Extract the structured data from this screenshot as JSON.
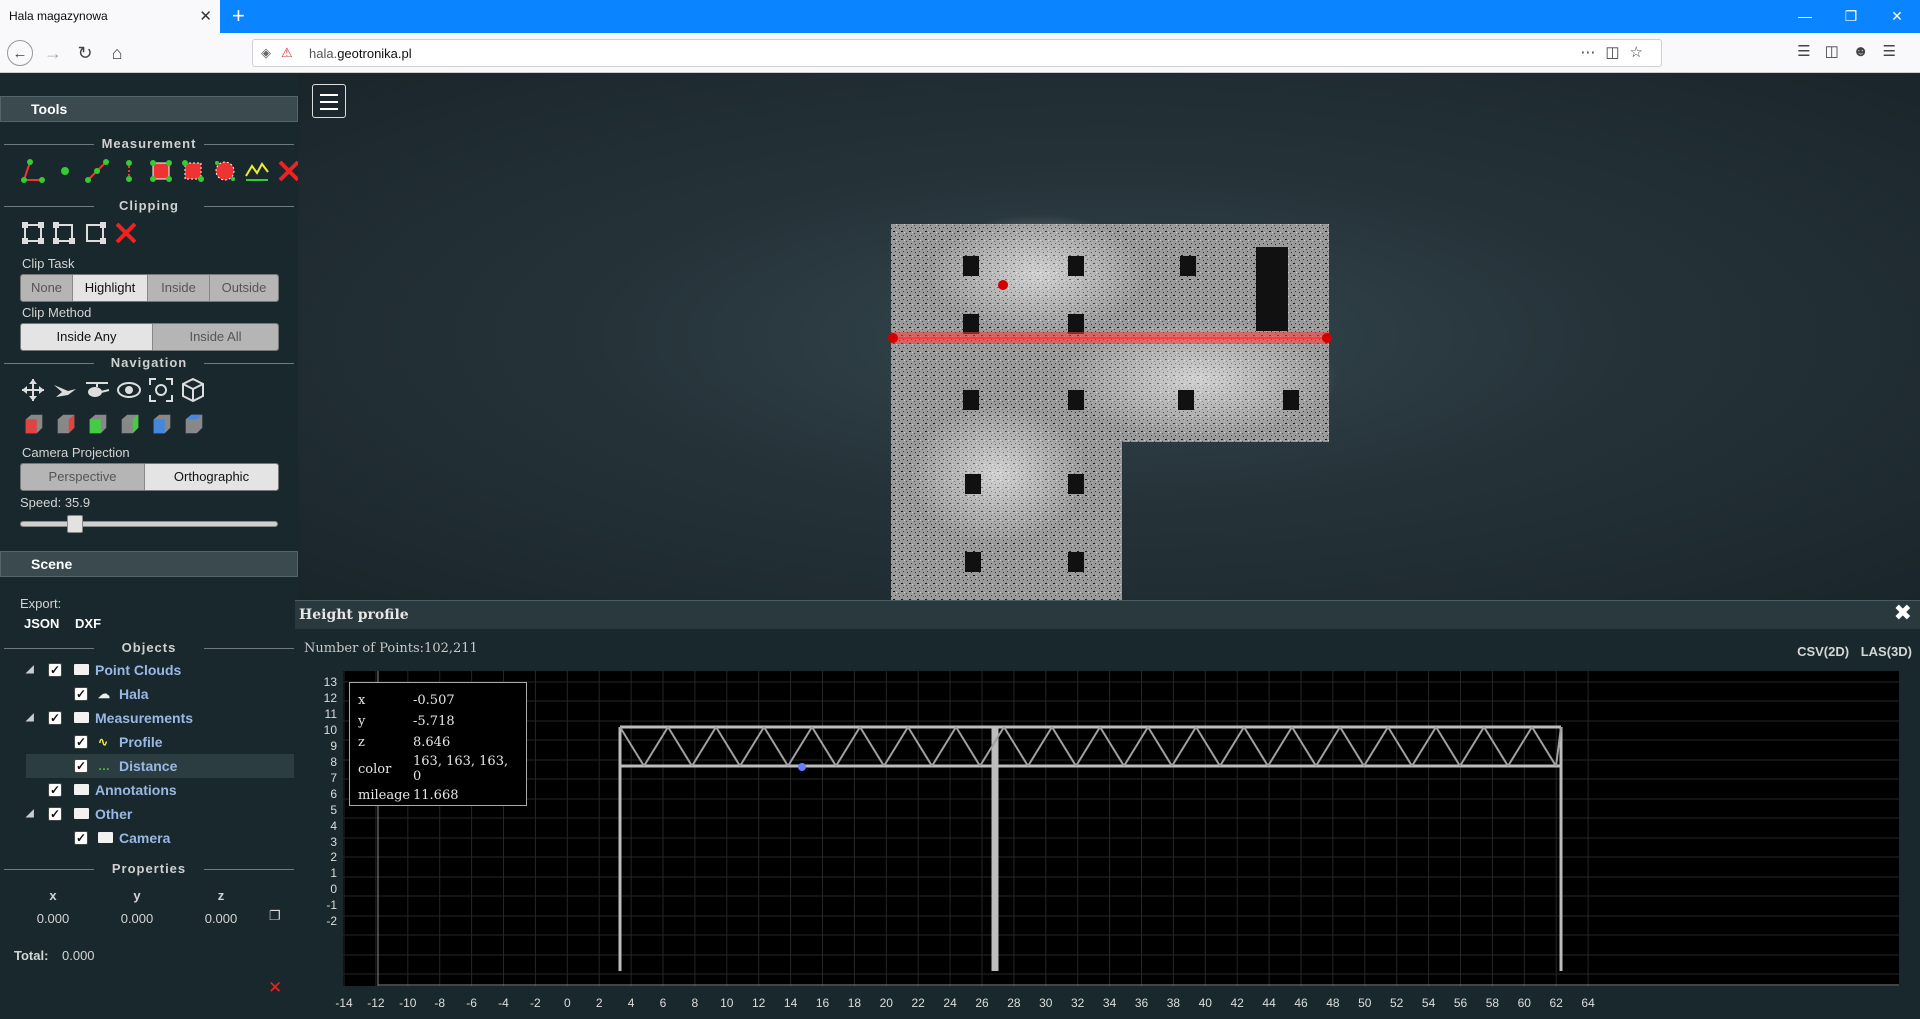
{
  "browser": {
    "tab_title": "Hala magazynowa",
    "url_host_prefix": "hala.",
    "url_host_main": "geotronika.pl",
    "new_tab_glyph": "+",
    "tab_close_glyph": "✕"
  },
  "sidebar": {
    "tools_title": "Tools",
    "measurement_title": "Measurement",
    "clipping_title": "Clipping",
    "clip_task_label": "Clip Task",
    "clip_task_options": [
      "None",
      "Highlight",
      "Inside",
      "Outside"
    ],
    "clip_task_selected": "Highlight",
    "clip_method_label": "Clip Method",
    "clip_method_options": [
      "Inside Any",
      "Inside All"
    ],
    "clip_method_selected": "Inside Any",
    "navigation_title": "Navigation",
    "camera_projection_label": "Camera Projection",
    "camera_projection_options": [
      "Perspective",
      "Orthographic"
    ],
    "camera_projection_selected": "Orthographic",
    "speed_label": "Speed: 35.9",
    "speed_fraction": 0.19,
    "scene_title": "Scene",
    "export_label": "Export:",
    "export_json": "JSON",
    "export_dxf": "DXF",
    "objects_title": "Objects",
    "tree": [
      {
        "name": "Point Clouds",
        "level": 0,
        "checked": true,
        "icon": "folder-icon"
      },
      {
        "name": "Hala",
        "level": 1,
        "checked": true,
        "icon": "cloud-icon"
      },
      {
        "name": "Measurements",
        "level": 0,
        "checked": true,
        "icon": "folder-icon"
      },
      {
        "name": "Profile",
        "level": 1,
        "checked": true,
        "icon": "profile-icon"
      },
      {
        "name": "Distance",
        "level": 1,
        "checked": true,
        "icon": "distance-icon",
        "selected": true
      },
      {
        "name": "Annotations",
        "level": 0,
        "checked": true,
        "icon": "folder-icon"
      },
      {
        "name": "Other",
        "level": 0,
        "checked": true,
        "icon": "folder-icon"
      },
      {
        "name": "Camera",
        "level": 1,
        "checked": true,
        "icon": "folder-icon"
      }
    ],
    "properties_title": "Properties",
    "coords": {
      "x_label": "x",
      "y_label": "y",
      "z_label": "z",
      "x": "0.000",
      "y": "0.000",
      "z": "0.000"
    },
    "total_label": "Total:",
    "total_value": "0.000"
  },
  "profile": {
    "title": "Height profile",
    "num_points": "Number of Points:102,211",
    "csv_label": "CSV(2D)",
    "las_label": "LAS(3D)",
    "y_ticks": [
      "13",
      "12",
      "11",
      "10",
      "9",
      "8",
      "7",
      "6",
      "5",
      "4",
      "3",
      "2",
      "1",
      "0",
      "-1",
      "-2"
    ],
    "x_ticks": [
      "-14",
      "-12",
      "-10",
      "-8",
      "-6",
      "-4",
      "-2",
      "0",
      "2",
      "4",
      "6",
      "8",
      "10",
      "12",
      "14",
      "16",
      "18",
      "20",
      "22",
      "24",
      "26",
      "28",
      "30",
      "32",
      "34",
      "36",
      "38",
      "40",
      "42",
      "44",
      "46",
      "48",
      "50",
      "52",
      "54",
      "56",
      "58",
      "60",
      "62",
      "64"
    ],
    "tooltip": [
      {
        "k": "x",
        "v": "-0.507"
      },
      {
        "k": "y",
        "v": "-5.718"
      },
      {
        "k": "z",
        "v": "8.646"
      },
      {
        "k": "color",
        "v": "163, 163, 163, 0"
      },
      {
        "k": "mileage",
        "v": "11.668"
      }
    ]
  },
  "colors": {
    "accent_blue": "#0a84ff",
    "profile_line": "#ff3b3b"
  }
}
